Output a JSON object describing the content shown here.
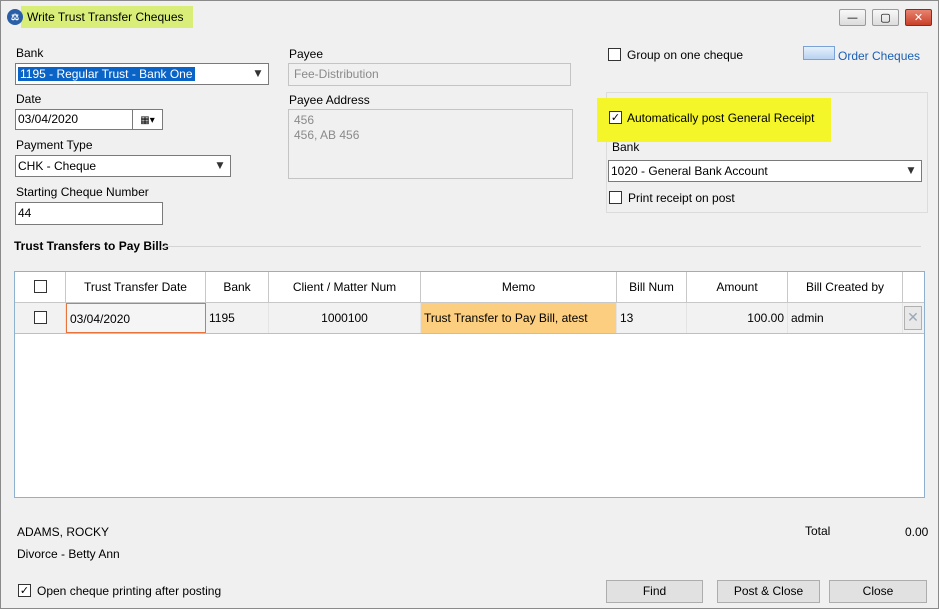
{
  "window": {
    "title": "Write Trust Transfer Cheques",
    "icon": "scales-icon",
    "controls": {
      "minimize": "—",
      "maximize": "▢",
      "close": "✕"
    }
  },
  "form": {
    "bank_label": "Bank",
    "bank_value": "1195 - Regular Trust - Bank One",
    "date_label": "Date",
    "date_value": "03/04/2020",
    "payment_type_label": "Payment Type",
    "payment_type_value": "CHK - Cheque",
    "starting_cheque_label": "Starting Cheque Number",
    "starting_cheque_value": "44",
    "payee_label": "Payee",
    "payee_value": "Fee-Distribution",
    "payee_address_label": "Payee Address",
    "payee_address_line1": "456",
    "payee_address_line2": "456, AB   456"
  },
  "options": {
    "group_on_one_cheque": "Group on one cheque",
    "group_checked": false,
    "order_cheques": "Order Cheques",
    "auto_post_receipt": "Automatically post General Receipt",
    "auto_post_checked": true,
    "receipt_bank_label": "Bank",
    "receipt_bank_value": "1020 - General Bank Account",
    "print_receipt": "Print receipt on post",
    "print_receipt_checked": false
  },
  "section_title": "Trust Transfers to Pay Bills",
  "grid": {
    "columns": [
      "Trust Transfer Date",
      "Bank",
      "Client / Matter Num",
      "Memo",
      "Bill Num",
      "Amount",
      "Bill Created by"
    ],
    "rows": [
      {
        "checked": false,
        "date": "03/04/2020",
        "bank": "1195",
        "client_matter": "1000100",
        "memo": "Trust Transfer to Pay Bill, atest",
        "bill_num": "13",
        "amount": "100.00",
        "created_by": "admin"
      }
    ]
  },
  "footer": {
    "client_name": "ADAMS, ROCKY",
    "matter_desc": "Divorce - Betty Ann",
    "total_label": "Total",
    "total_value": "0.00",
    "open_printing": "Open cheque printing after posting",
    "open_printing_checked": true,
    "find_button": "Find",
    "post_close_button": "Post & Close",
    "close_button": "Close"
  },
  "colors": {
    "title_highlight": "#d9ee78",
    "annotation_highlight": "#f4f62a",
    "selection_blue": "#0a64c8",
    "memo_cell": "#fbcf7f",
    "link_blue": "#1a5fb4"
  }
}
